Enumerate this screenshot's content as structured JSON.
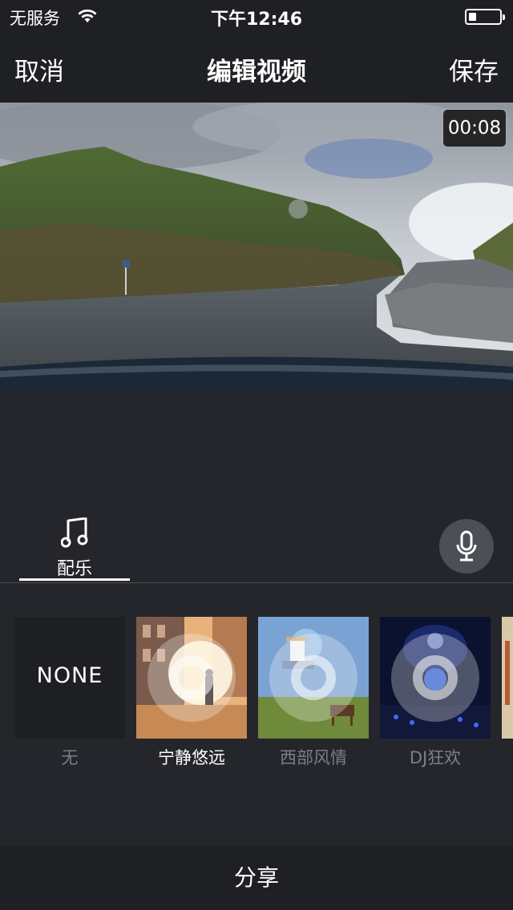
{
  "status_bar": {
    "carrier": "无服务",
    "time": "下午12:46",
    "battery_level": 0.25,
    "wifi_icon": "wifi-icon",
    "battery_icon": "battery-icon"
  },
  "nav": {
    "cancel_label": "取消",
    "title": "编辑视频",
    "save_label": "保存"
  },
  "video": {
    "duration": "00:08"
  },
  "music": {
    "tab_label": "配乐",
    "tab_icon": "music-note-icon",
    "mic_icon": "microphone-icon",
    "tracks": [
      {
        "label": "无",
        "thumb_text": "NONE",
        "selected": false
      },
      {
        "label": "宁静悠远",
        "selected": true
      },
      {
        "label": "西部风情",
        "selected": false
      },
      {
        "label": "DJ狂欢",
        "selected": false
      }
    ]
  },
  "footer": {
    "share_label": "分享"
  },
  "colors": {
    "background": "#25262b",
    "bar": "#1f2024",
    "inactive_label": "#7c7f86",
    "accent": "#ffffff"
  }
}
